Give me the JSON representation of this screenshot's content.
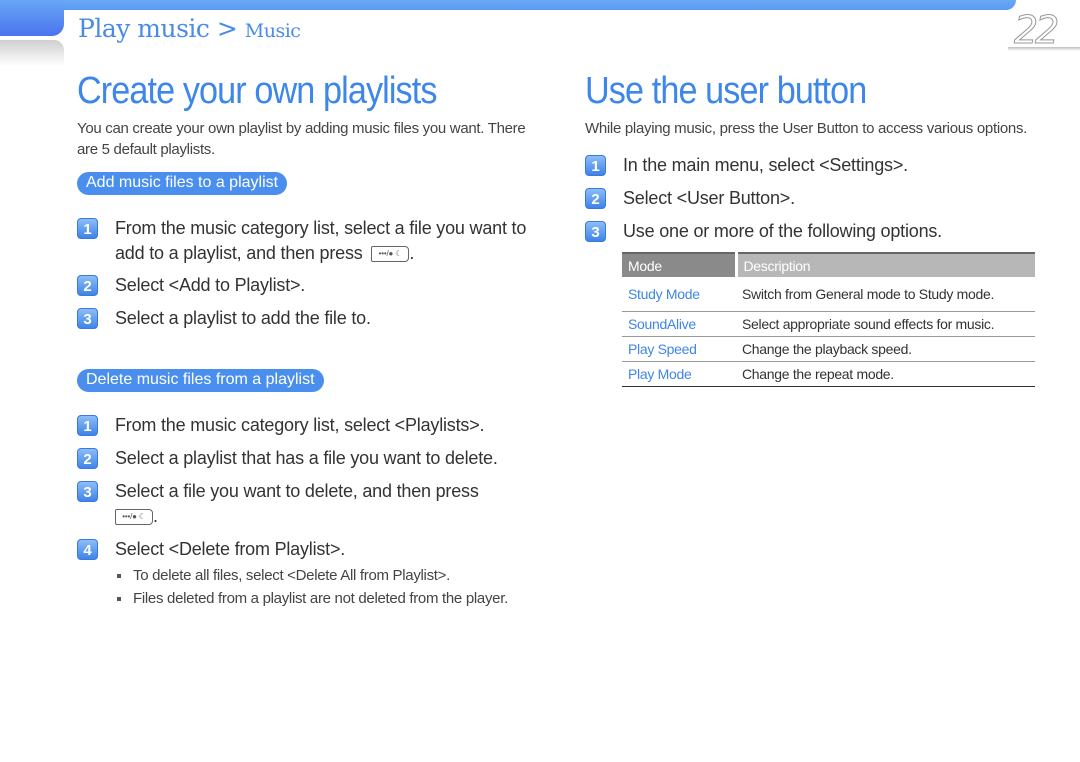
{
  "header": {
    "breadcrumb_main": "Play music >",
    "breadcrumb_sub": "Music",
    "page_number": "22",
    "accent_color": "#4a8be9"
  },
  "left": {
    "title": "Create your own playlists",
    "intro": "You can create your own playlist by adding music files you want. There are 5 default playlists.",
    "sections": [
      {
        "pill": "Add music files to a playlist",
        "steps": [
          {
            "num": "1",
            "text": "From the music category list, select a file you want to add to a playlist, and then press",
            "key": "•••/● ☾",
            "after": "."
          },
          {
            "num": "2",
            "text": "Select <Add to Playlist>."
          },
          {
            "num": "3",
            "text": "Select a playlist to add the file to."
          }
        ]
      },
      {
        "pill": "Delete music files from a playlist",
        "steps": [
          {
            "num": "1",
            "text": "From the music category list, select <Playlists>."
          },
          {
            "num": "2",
            "text": "Select a playlist that has a file you want to delete."
          },
          {
            "num": "3",
            "text": "Select a file you want to delete, and then press",
            "key": "•••/● ☾",
            "after": "."
          },
          {
            "num": "4",
            "text": "Select <Delete from Playlist>."
          }
        ],
        "bullets": [
          "To delete all files, select <Delete All from Playlist>.",
          "Files deleted from a playlist are not deleted from the player."
        ]
      }
    ]
  },
  "right": {
    "title": "Use the user button",
    "intro": "While playing music, press the User Button to access various options.",
    "steps": [
      {
        "num": "1",
        "text": "In the main menu, select <Settings>."
      },
      {
        "num": "2",
        "text": "Select <User Button>."
      },
      {
        "num": "3",
        "text": "Use one or more of the following options."
      }
    ],
    "table": {
      "headers": [
        "Mode",
        "Description"
      ],
      "rows": [
        {
          "mode": "Study Mode",
          "description": "Switch from General mode to Study mode."
        },
        {
          "mode": "SoundAlive",
          "description": "Select appropriate sound effects for music."
        },
        {
          "mode": "Play Speed",
          "description": "Change the playback speed."
        },
        {
          "mode": "Play Mode",
          "description": "Change the repeat mode."
        }
      ]
    }
  }
}
